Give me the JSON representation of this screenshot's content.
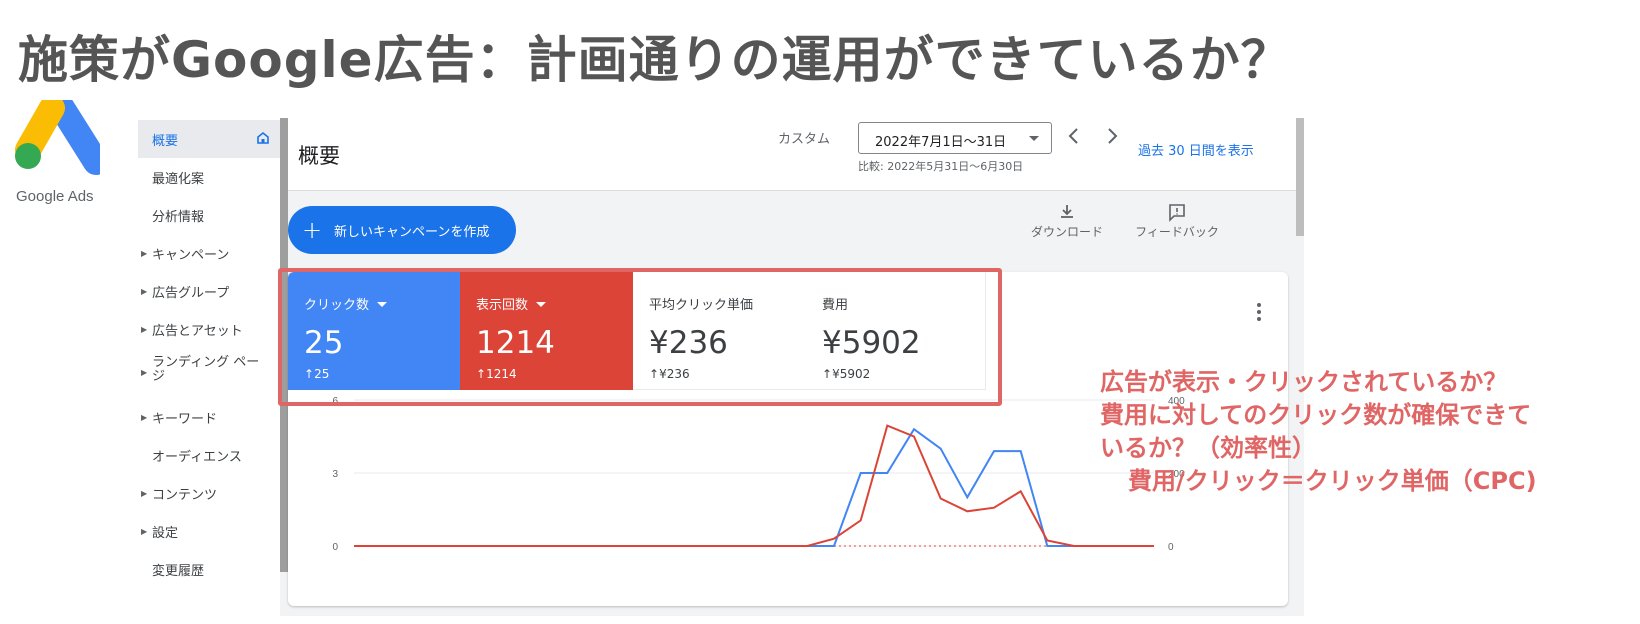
{
  "slide": {
    "title": "施策がGoogle広告：計画通りの運用ができているか？",
    "logo_text": "Google Ads"
  },
  "sidebar": {
    "items": [
      {
        "label": "概要",
        "active": true
      },
      {
        "label": "最適化案"
      },
      {
        "label": "分析情報"
      },
      {
        "label": "キャンペーン",
        "expandable": true
      },
      {
        "label": "広告グループ",
        "expandable": true
      },
      {
        "label": "広告とアセット",
        "expandable": true
      },
      {
        "label": "ランディング ページ",
        "expandable": true
      },
      {
        "label": "キーワード",
        "expandable": true
      },
      {
        "label": "オーディエンス"
      },
      {
        "label": "コンテンツ",
        "expandable": true
      },
      {
        "label": "設定",
        "expandable": true
      },
      {
        "label": "変更履歴"
      }
    ]
  },
  "header": {
    "page_title": "概要",
    "custom_label": "カスタム",
    "date_range": "2022年7月1日〜31日",
    "compare_text": "比較: 2022年5月31日〜6月30日",
    "last_30_link": "過去 30 日間を表示"
  },
  "toolbar": {
    "new_campaign": "新しいキャンペーンを作成",
    "download": "ダウンロード",
    "feedback": "フィードバック"
  },
  "metrics": [
    {
      "label": "クリック数",
      "value": "25",
      "delta": "25",
      "color": "#4285f4",
      "dropdown": true
    },
    {
      "label": "表示回数",
      "value": "1214",
      "delta": "1214",
      "color": "#db4437",
      "dropdown": true
    },
    {
      "label": "平均クリック単価",
      "value": "¥236",
      "delta": "¥236"
    },
    {
      "label": "費用",
      "value": "¥5902",
      "delta": "¥5902"
    }
  ],
  "chart_data": {
    "type": "line",
    "left_axis": {
      "ticks": [
        "6",
        "3",
        "0"
      ],
      "ylim": [
        0,
        6
      ]
    },
    "right_axis": {
      "ticks": [
        "400",
        "200",
        "0"
      ],
      "ylim": [
        0,
        400
      ]
    },
    "x": [
      1,
      2,
      3,
      4,
      5,
      6,
      7,
      8,
      9,
      10,
      11,
      12,
      13,
      14,
      15,
      16,
      17,
      18,
      19,
      20,
      21,
      22,
      23,
      24,
      25,
      26,
      27,
      28,
      29,
      30,
      31
    ],
    "series": [
      {
        "color": "#4285f4",
        "axis": "left",
        "values": [
          0,
          0,
          0,
          0,
          0,
          0,
          0,
          0,
          0,
          0,
          0,
          0,
          0,
          0,
          0,
          0,
          0,
          0,
          0,
          3,
          3,
          4.8,
          4,
          2,
          3.9,
          3.9,
          0,
          0,
          0,
          0,
          0
        ]
      },
      {
        "color": "#db4437",
        "axis": "right",
        "values": [
          0,
          0,
          0,
          0,
          0,
          0,
          0,
          0,
          0,
          0,
          0,
          0,
          0,
          0,
          0,
          0,
          0,
          0,
          20,
          70,
          330,
          300,
          130,
          95,
          105,
          150,
          15,
          0,
          0,
          0,
          0
        ]
      }
    ],
    "grid": true
  },
  "annotation": {
    "lines": [
      "広告が表示・クリックされているか？",
      "費用に対してのクリック数が確保できて",
      "いるか？（効率性）",
      "費用/クリック＝クリック単価（CPC)"
    ]
  }
}
